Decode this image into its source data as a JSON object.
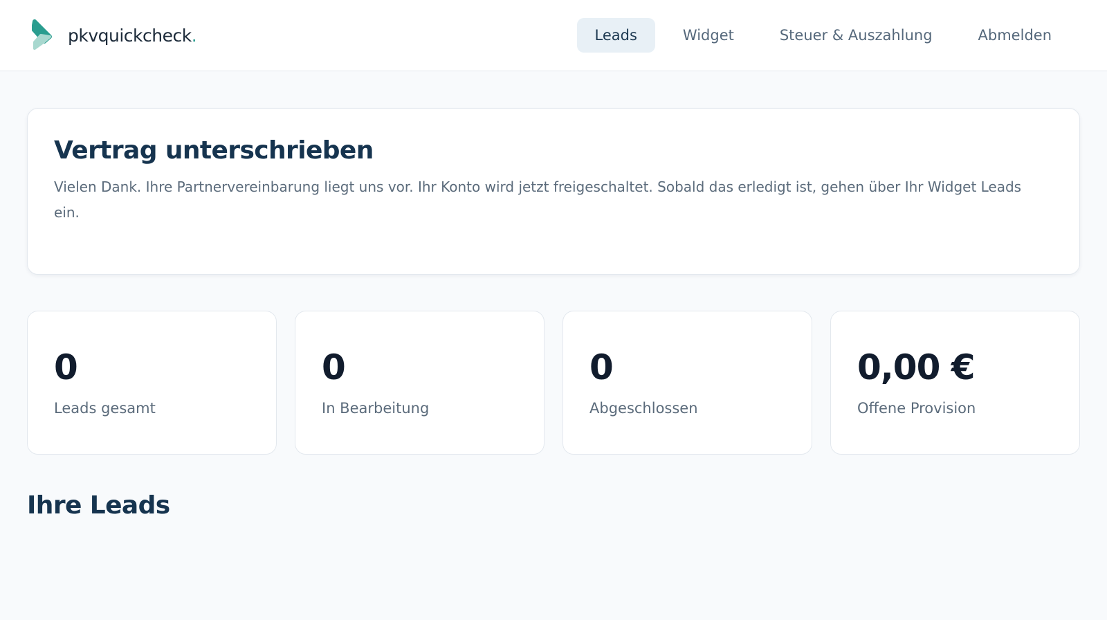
{
  "brand": {
    "name": "pkvquickcheck",
    "dot": ".",
    "accent_color": "#2a9d8f",
    "logo_icon": "chevron-logo-icon"
  },
  "nav": {
    "items": [
      {
        "label": "Leads",
        "active": true
      },
      {
        "label": "Widget",
        "active": false
      },
      {
        "label": "Steuer & Auszahlung",
        "active": false
      },
      {
        "label": "Abmelden",
        "active": false
      }
    ]
  },
  "notice": {
    "title": "Vertrag unterschrieben",
    "text": "Vielen Dank. Ihre Partnervereinbarung liegt uns vor. Ihr Konto wird jetzt freigeschaltet. Sobald das erledigt ist, gehen über Ihr Widget Leads ein."
  },
  "stats": [
    {
      "value": "0",
      "label": "Leads gesamt"
    },
    {
      "value": "0",
      "label": "In Bearbeitung"
    },
    {
      "value": "0",
      "label": "Abgeschlossen"
    },
    {
      "value": "0,00 €",
      "label": "Offene Provision"
    }
  ],
  "leads_section": {
    "title": "Ihre Leads"
  }
}
